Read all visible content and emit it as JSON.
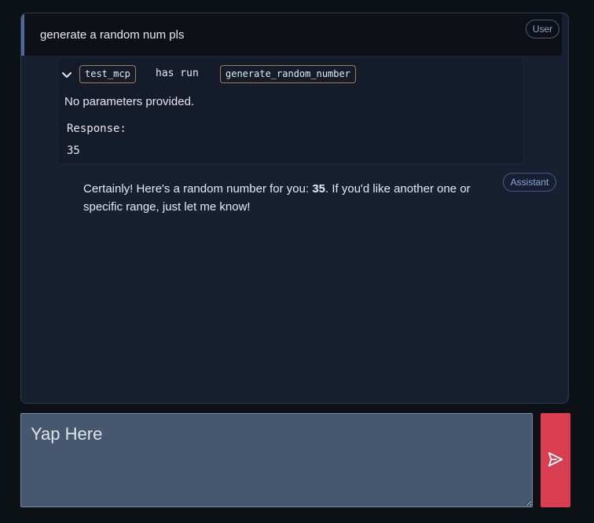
{
  "user_message": {
    "text": "generate a random num pls",
    "role": "User"
  },
  "tool_call": {
    "server": "test_mcp",
    "action_text": "has run",
    "tool": "generate_random_number",
    "params_text": "No parameters provided.",
    "response_label": "Response:",
    "response_value": "35",
    "toggle_icon": "chevron-down-icon"
  },
  "assistant_message": {
    "role": "Assistant",
    "text_before": "Certainly! Here's a random number for you: ",
    "bold_value": "35",
    "text_after": ". If you'd like another one or specific range, just let me know!"
  },
  "composer": {
    "placeholder": "Yap Here",
    "send_icon": "send-icon"
  },
  "colors": {
    "background": "#0b1114",
    "panel": "#172031",
    "accent_send": "#d93e50",
    "tag_border": "#a77d48",
    "badge_text": "#8ca6d2"
  }
}
